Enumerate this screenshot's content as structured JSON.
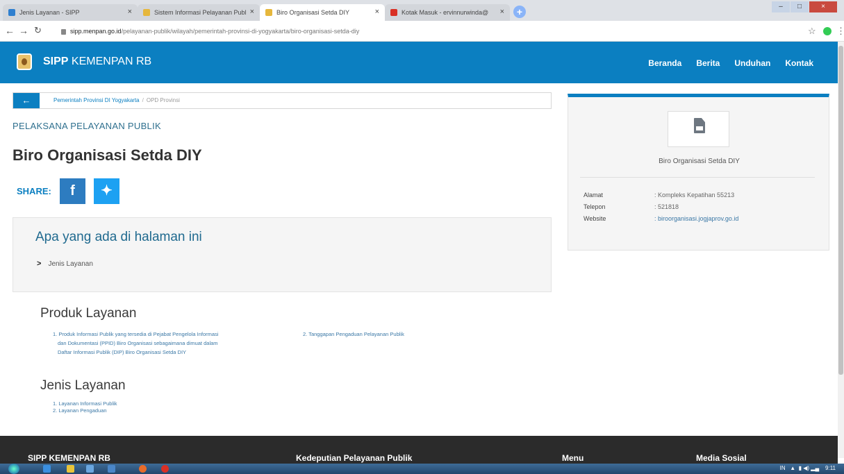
{
  "browser": {
    "tabs": [
      {
        "label": "Jenis Layanan - SIPP",
        "active": false,
        "color": "#2f7fcf"
      },
      {
        "label": "Sistem Informasi Pelayanan Publ",
        "active": false,
        "color": "#e6b73c"
      },
      {
        "label": "Biro Organisasi Setda DIY",
        "active": true,
        "color": "#e6b73c"
      },
      {
        "label": "Kotak Masuk - ervinnurwinda@",
        "active": false,
        "color": "#d93025"
      }
    ],
    "url_domain": "sipp.menpan.go.id",
    "url_path": "/pelayanan-publik/wilayah/pemerintah-provinsi-di-yogyakarta/biro-organisasi-setda-diy"
  },
  "header": {
    "brand_bold": "SIPP",
    "brand_rest": "KEMENPAN RB",
    "nav": [
      "Beranda",
      "Berita",
      "Unduhan",
      "Kontak"
    ]
  },
  "breadcrumb": {
    "back": "←",
    "link": "Pemerintah Provinsi DI Yogyakarta",
    "sep": "/",
    "current": "OPD Provinsi"
  },
  "page": {
    "pre_title": "PELAKSANA PELAYANAN PUBLIK",
    "title": "Biro Organisasi Setda DIY",
    "share_label": "SHARE:",
    "fb": "f",
    "tw": "✦"
  },
  "toc": {
    "title": "Apa yang ada di halaman ini",
    "items": [
      "Jenis Layanan"
    ]
  },
  "produk": {
    "title": "Produk Layanan",
    "item1_line1": "1. Produk Informasi Publik yang tersedia di Pejabat Pengelola Informasi",
    "item1_line2": "dan Dokumentasi (PPID) Biro Organisasi sebagaimana dimuat dalam",
    "item1_line3": "Daftar Informasi Publik (DIP) Biro Organisasi Setda DIY",
    "item2": "2. Tanggapan Pengaduan Pelayanan Publik"
  },
  "jenis": {
    "title": "Jenis Layanan",
    "items": [
      "1. Layanan Informasi Publik",
      "2. Layanan Pengaduan"
    ]
  },
  "card": {
    "name": "Biro Organisasi Setda DIY",
    "rows": [
      {
        "label": "Alamat",
        "value": ":  Kompleks Kepatihan 55213"
      },
      {
        "label": "Telepon",
        "value": ":  521818"
      },
      {
        "label": "Website",
        "value": ":  biroorganisasi.jogjaprov.go.id"
      }
    ]
  },
  "footer": {
    "cols": [
      "SIPP KEMENPAN RB",
      "Kedeputian Pelayanan Publik",
      "Menu",
      "Media Sosial"
    ]
  },
  "taskbar": {
    "lang": "IN",
    "time": "9:11"
  }
}
